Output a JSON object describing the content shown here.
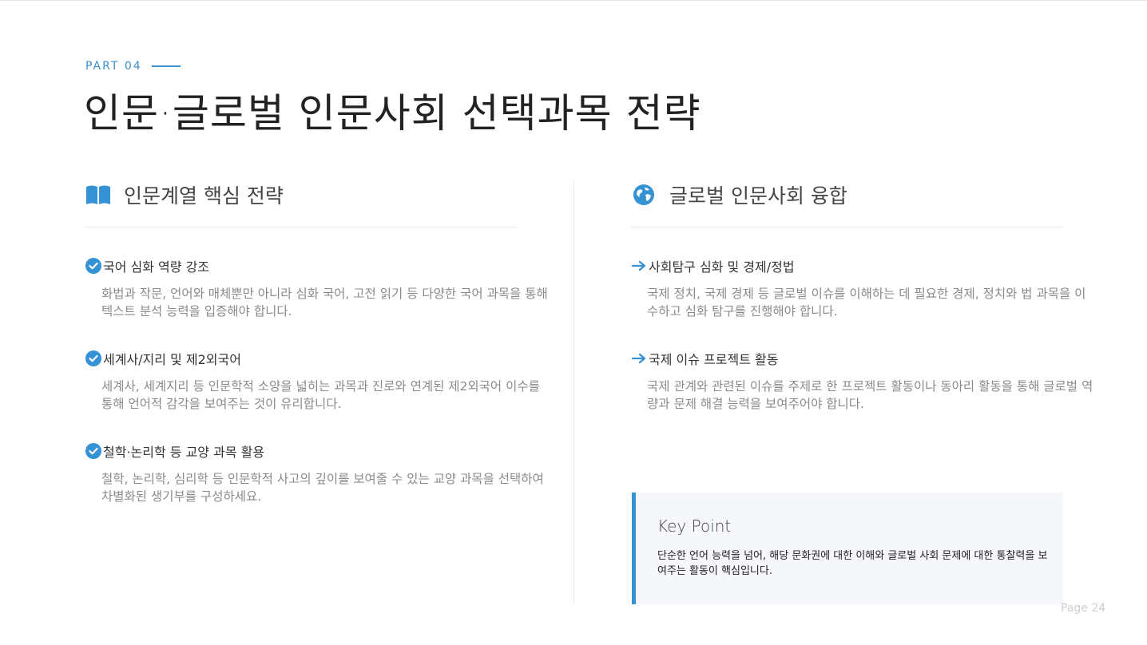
{
  "header": {
    "part_label": "PART 04",
    "title": "인문·글로벌 인문사회 선택과목 전략"
  },
  "left_column": {
    "heading": "인문계열 핵심 전략",
    "icon": "book-icon",
    "items": [
      {
        "icon": "check-circle-icon",
        "title": "국어 심화 역량 강조",
        "desc": "화법과 작문, 언어와 매체뿐만 아니라 심화 국어, 고전 읽기 등 다양한 국어 과목을 통해 텍스트 분석 능력을 입증해야 합니다."
      },
      {
        "icon": "check-circle-icon",
        "title": "세계사/지리 및 제2외국어",
        "desc": "세계사, 세계지리 등 인문학적 소양을 넓히는 과목과 진로와 연계된 제2외국어 이수를 통해 언어적 감각을 보여주는 것이 유리합니다."
      },
      {
        "icon": "check-circle-icon",
        "title": "철학·논리학 등 교양 과목 활용",
        "desc": "철학, 논리학, 심리학 등 인문학적 사고의 깊이를 보여줄 수 있는 교양 과목을 선택하여 차별화된 생기부를 구성하세요."
      }
    ]
  },
  "right_column": {
    "heading": "글로벌 인문사회 융합",
    "icon": "globe-icon",
    "items": [
      {
        "icon": "arrow-right-icon",
        "title": "사회탐구 심화 및 경제/정법",
        "desc": "국제 정치, 국제 경제 등 글로벌 이슈를 이해하는 데 필요한 경제, 정치와 법 과목을 이수하고 심화 탐구를 진행해야 합니다."
      },
      {
        "icon": "arrow-right-icon",
        "title": "국제 이슈 프로젝트 활동",
        "desc": "국제 관계와 관련된 이슈를 주제로 한 프로젝트 활동이나 동아리 활동을 통해 글로벌 역량과 문제 해결 능력을 보여주어야 합니다."
      }
    ]
  },
  "key_point": {
    "title": "Key Point",
    "text": "단순한 언어 능력을 넘어, 해당 문화권에 대한 이해와 글로벌 사회 문제에 대한 통찰력을 보여주는 활동이 핵심입니다."
  },
  "footer": {
    "page": "Page 24"
  },
  "colors": {
    "accent": "#3592d4",
    "muted_text": "#8a8a8a"
  }
}
